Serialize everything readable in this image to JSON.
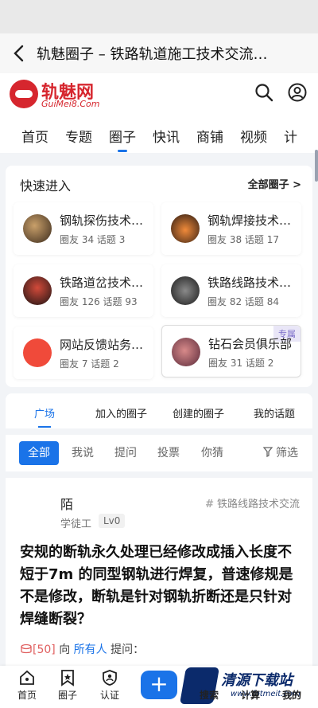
{
  "window": {
    "title": "轨魅圈子 – 铁路轨道施工技术交流…"
  },
  "site": {
    "brand": "轨魅网",
    "domain": "GuiMei8.Com"
  },
  "nav": [
    "首页",
    "专题",
    "圈子",
    "快讯",
    "商铺",
    "视频",
    "计"
  ],
  "nav_active": "圈子",
  "quick": {
    "heading": "快速进入",
    "all_label": "全部圈子 >",
    "items": [
      {
        "name": "钢轨探伤技术…",
        "stats": "圈友 34 话题 3",
        "badge": ""
      },
      {
        "name": "钢轨焊接技术…",
        "stats": "圈友 38 话题 17",
        "badge": ""
      },
      {
        "name": "铁路道岔技术…",
        "stats": "圈友 126 话题 93",
        "badge": ""
      },
      {
        "name": "铁路线路技术…",
        "stats": "圈友 82 话题 84",
        "badge": ""
      },
      {
        "name": "网站反馈站务…",
        "stats": "圈友 7 话题 2",
        "badge": ""
      },
      {
        "name": "钻石会员俱乐部",
        "stats": "圈友 31 话题 2",
        "badge": "专属"
      }
    ]
  },
  "feed_tabs": [
    "广场",
    "加入的圈子",
    "创建的圈子",
    "我的话题"
  ],
  "filters": [
    "全部",
    "我说",
    "提问",
    "投票",
    "你猜"
  ],
  "filter_button": "筛选",
  "post": {
    "user": "陌",
    "role": "学徒工",
    "level": "Lv0",
    "tag": "铁路线路技术交流",
    "title": "安规的断轨永久处理已经修改成插入长度不短于7m 的同型钢轨进行焊复，普速修规是不是修改，断轨是针对钢轨折断还是只针对焊缝断裂？",
    "reward_coin": "[50]",
    "reward_to": "向",
    "reward_who": "所有人",
    "reward_action": "提问："
  },
  "bottom_tabs": [
    "首页",
    "圈子",
    "认证",
    "搜索",
    "计算",
    "我的"
  ],
  "fab": "+",
  "watermark": {
    "text": "清源下载站",
    "url": "www.fotmeit.com"
  },
  "colors": {
    "accent": "#1a73e8",
    "brand": "#d6262e"
  }
}
